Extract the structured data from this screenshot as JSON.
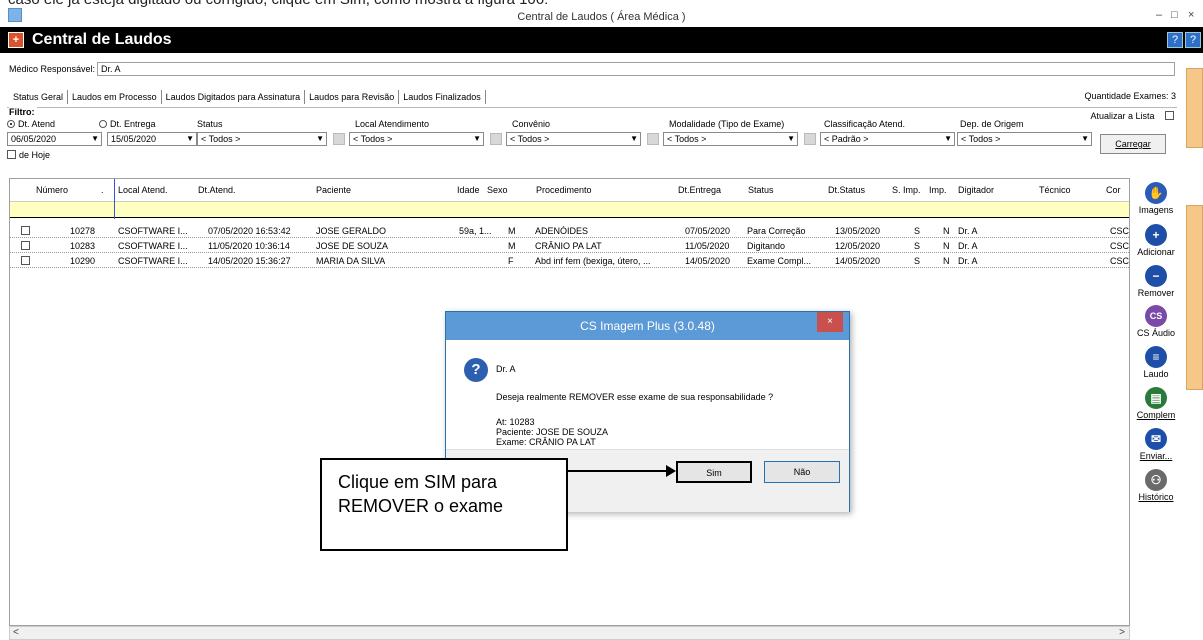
{
  "doc_strip": "caso ele já esteja digitado ou corrigido, clique em Sim, como mostra a figura 106:",
  "window": {
    "title": "Central de Laudos ( Área Médica )",
    "min": "–",
    "max": "□",
    "close": "×"
  },
  "app": {
    "title": "Central de Laudos",
    "logo": "+",
    "help_icons": [
      "?",
      "?"
    ]
  },
  "medico": {
    "label": "Médico Responsável:",
    "value": "Dr. A"
  },
  "tabs": [
    "Status Geral",
    "Laudos em Processo",
    "Laudos Digitados para Assinatura",
    "Laudos para Revisão",
    "Laudos Finalizados"
  ],
  "quantidade": "Quantidade Exames: 3",
  "filtro": {
    "legend": "Filtro:",
    "atualizar": "Atualizar a Lista",
    "dt_atend": "Dt. Atend",
    "dt_entrega": "Dt. Entrega",
    "labels": {
      "status": "Status",
      "local": "Local Atendimento",
      "convenio": "Convênio",
      "modalidade": "Modalidade (Tipo de Exame)",
      "classificacao": "Classificação Atend.",
      "dep": "Dep. de Origem"
    },
    "date_from": "06/05/2020",
    "date_to": "15/05/2020",
    "status": "< Todos >",
    "local": "< Todos >",
    "convenio": "< Todos >",
    "modalidade": "< Todos >",
    "classificacao": "< Padrão >",
    "dep": "< Todos >",
    "de_hoje": "de Hoje",
    "carregar": "Carregar"
  },
  "table": {
    "headers": [
      "Número",
      ".",
      "Local Atend.",
      "Dt.Atend.",
      "Paciente",
      "Idade",
      "Sexo",
      "Procedimento",
      "Dt.Entrega",
      "Status",
      "Dt.Status",
      "S. Imp.",
      "Imp.",
      "Digitador",
      "Técnico",
      "Cor"
    ],
    "rows": [
      [
        "10278",
        "CSOFTWARE I...",
        "07/05/2020 16:53:42",
        "JOSE GERALDO",
        "59a, 1...",
        "M",
        "ADENÓIDES",
        "07/05/2020",
        "Para Correção",
        "13/05/2020",
        "S",
        "N",
        "Dr. A",
        "",
        "CSC"
      ],
      [
        "10283",
        "CSOFTWARE I...",
        "11/05/2020 10:36:14",
        "JOSE DE SOUZA",
        "",
        "M",
        "CRÂNIO PA LAT",
        "11/05/2020",
        "Digitando",
        "12/05/2020",
        "S",
        "N",
        "Dr. A",
        "",
        "CSC"
      ],
      [
        "10290",
        "CSOFTWARE I...",
        "14/05/2020 15:36:27",
        "MARIA DA SILVA",
        "",
        "F",
        "Abd inf fem (bexiga, útero, ...",
        "14/05/2020",
        "Exame Compl...",
        "14/05/2020",
        "S",
        "N",
        "Dr. A",
        "",
        "CSC"
      ]
    ]
  },
  "scroll": {
    "left": "<",
    "right": ">"
  },
  "sidebar": [
    {
      "label": "Imagens",
      "icon": "hand-icon",
      "color": "#2a5bb8",
      "glyph": "✋"
    },
    {
      "label": "Adicionar",
      "icon": "plus-icon",
      "color": "#1e4fa8",
      "glyph": "+"
    },
    {
      "label": "Remover",
      "icon": "minus-icon",
      "color": "#1e4fa8",
      "glyph": "−"
    },
    {
      "label": "CS Áudio",
      "icon": "cs-audio-icon",
      "color": "#7a4aa8",
      "glyph": "CS"
    },
    {
      "label": "Laudo",
      "icon": "document-icon",
      "color": "#1e4fa8",
      "glyph": "≡"
    },
    {
      "label": "Complem",
      "icon": "complemento-icon",
      "color": "#2a7a3a",
      "glyph": "▤"
    },
    {
      "label": "Enviar...",
      "icon": "mail-icon",
      "color": "#1e4fa8",
      "glyph": "✉"
    },
    {
      "label": "Histórico",
      "icon": "history-icon",
      "color": "#6a6a6a",
      "glyph": "⚇"
    }
  ],
  "dialog": {
    "title": "CS Imagem Plus (3.0.48)",
    "close": "×",
    "icon": "?",
    "user": "Dr. A",
    "question": "Deseja realmente REMOVER esse exame de sua responsabilidade ?",
    "at": "At: 10283",
    "paciente": "Paciente: JOSE DE SOUZA",
    "exame": "Exame: CRÂNIO PA LAT",
    "sim": "Sim",
    "nao": "Não"
  },
  "callout": {
    "line1": "Clique em SIM para",
    "line2": "REMOVER o exame"
  }
}
